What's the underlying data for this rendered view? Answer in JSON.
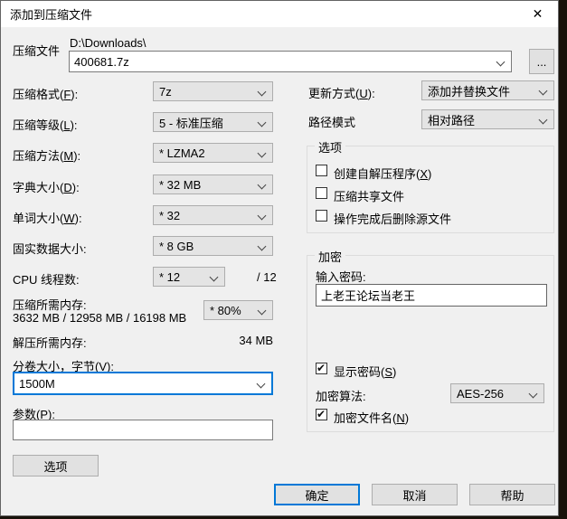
{
  "window": {
    "title": "添加到压缩文件"
  },
  "archive": {
    "label": "压缩文件",
    "dir": "D:\\Downloads\\",
    "name": "400681.7z",
    "browse": "..."
  },
  "left": {
    "rows": [
      {
        "label": "压缩格式(F):",
        "value": "7z"
      },
      {
        "label": "压缩等级(L):",
        "value": "5 - 标准压缩"
      },
      {
        "label": "压缩方法(M):",
        "value": "* LZMA2"
      },
      {
        "label": "字典大小(D):",
        "value": "* 32 MB"
      },
      {
        "label": "单词大小(W):",
        "value": "* 32"
      },
      {
        "label": "固实数据大小:",
        "value": "* 8 GB"
      },
      {
        "label": "CPU 线程数:",
        "value": "* 12",
        "suffix": "/ 12"
      }
    ]
  },
  "memory": {
    "compress_label": "压缩所需内存:",
    "compress_value": "3632 MB / 12958 MB / 16198 MB",
    "usage_value": "* 80%",
    "decompress_label": "解压所需内存:",
    "decompress_value": "34 MB"
  },
  "split": {
    "label": "分卷大小，字节(V):",
    "value": "1500M"
  },
  "params": {
    "label": "参数(P):",
    "value": ""
  },
  "options_button": "选项",
  "right": {
    "update_label": "更新方式(U):",
    "update_value": "添加并替换文件",
    "path_label": "路径模式",
    "path_value": "相对路径"
  },
  "options_group": {
    "title": "选项",
    "items": [
      {
        "label": "创建自解压程序(X)",
        "checked": false
      },
      {
        "label": "压缩共享文件",
        "checked": false
      },
      {
        "label": "操作完成后删除源文件",
        "checked": false
      }
    ]
  },
  "encryption": {
    "title": "加密",
    "password_label": "输入密码:",
    "password_value": "上老王论坛当老王",
    "show_password": {
      "label": "显示密码(S)",
      "checked": true
    },
    "method_label": "加密算法:",
    "method_value": "AES-256",
    "encrypt_names": {
      "label": "加密文件名(N)",
      "checked": true
    }
  },
  "footer": {
    "ok": "确定",
    "cancel": "取消",
    "help": "帮助"
  },
  "colors": {
    "accent": "#0078d7",
    "dialog_bg": "#f0f0f0",
    "titlebar_bg": "#ffffff"
  }
}
